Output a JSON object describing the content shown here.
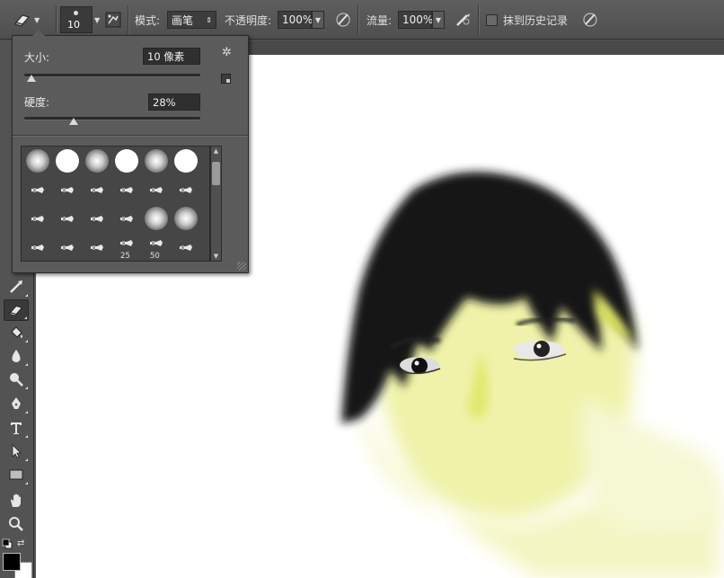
{
  "options_bar": {
    "brush_size": "10",
    "mode_label": "模式:",
    "mode_value": "画笔",
    "opacity_label": "不透明度:",
    "opacity_value": "100%",
    "flow_label": "流量:",
    "flow_value": "100%",
    "history_label": "抹到历史记录"
  },
  "brush_picker": {
    "size_label": "大小:",
    "size_value": "10 像素",
    "size_fraction": 0.04,
    "hardness_label": "硬度:",
    "hardness_value": "28%",
    "hardness_fraction": 0.28,
    "presets": [
      {
        "kind": "soft-round"
      },
      {
        "kind": "hard-round"
      },
      {
        "kind": "soft-round"
      },
      {
        "kind": "hard-round"
      },
      {
        "kind": "soft-round"
      },
      {
        "kind": "hard-round"
      },
      {
        "kind": "small-tip"
      },
      {
        "kind": "small-tip"
      },
      {
        "kind": "small-tip"
      },
      {
        "kind": "small-tip"
      },
      {
        "kind": "small-tip"
      },
      {
        "kind": "small-tip"
      },
      {
        "kind": "small-tip"
      },
      {
        "kind": "small-tip"
      },
      {
        "kind": "small-tip"
      },
      {
        "kind": "small-tip"
      },
      {
        "kind": "soft-round"
      },
      {
        "kind": "soft-round"
      },
      {
        "kind": "small-tip"
      },
      {
        "kind": "small-tip"
      },
      {
        "kind": "small-tip"
      },
      {
        "kind": "small-tip",
        "label": "25"
      },
      {
        "kind": "small-tip",
        "label": "50"
      },
      {
        "kind": "small-tip"
      }
    ]
  },
  "toolbox": {
    "tools": [
      "history-brush-tool",
      "eraser-tool",
      "paint-bucket-tool",
      "blur-tool",
      "dodge-tool",
      "pen-tool",
      "type-tool",
      "path-selection-tool",
      "rectangle-tool",
      "hand-tool",
      "zoom-tool"
    ],
    "active_tool": "eraser-tool"
  },
  "colors": {
    "foreground": "#000000",
    "background": "#ffffff",
    "hair": "#111111",
    "skin": "#f1f3a6"
  }
}
